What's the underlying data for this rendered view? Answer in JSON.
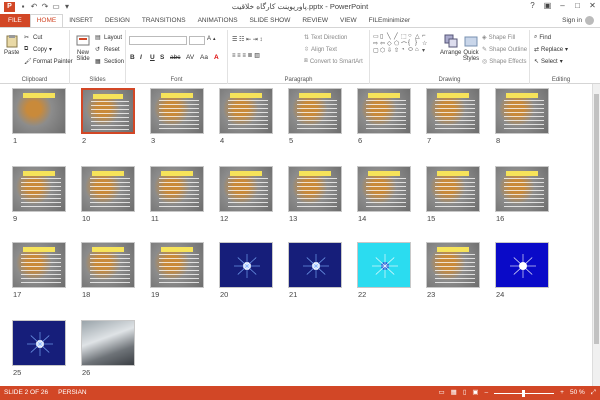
{
  "app": {
    "title": "پاورپوینت کارگاه خلاقیت.pptx - PowerPoint",
    "icon_letter": "P",
    "signin": "Sign in"
  },
  "tabs": [
    "FILE",
    "HOME",
    "INSERT",
    "DESIGN",
    "TRANSITIONS",
    "ANIMATIONS",
    "SLIDE SHOW",
    "REVIEW",
    "VIEW",
    "FILEminimizer"
  ],
  "active_tab": "HOME",
  "ribbon": {
    "clipboard": {
      "label": "Clipboard",
      "paste": "Paste",
      "cut": "Cut",
      "copy": "Copy",
      "format_painter": "Format Painter"
    },
    "slides": {
      "label": "Slides",
      "new_slide": "New Slide",
      "layout": "Layout",
      "reset": "Reset",
      "section": "Section"
    },
    "font": {
      "label": "Font",
      "bold": "B",
      "italic": "I",
      "underline": "U",
      "shadow": "S",
      "strike": "abc",
      "spacing": "AV",
      "case": "Aa",
      "color": "A"
    },
    "paragraph": {
      "label": "Paragraph",
      "text_direction": "Text Direction",
      "align_text": "Align Text",
      "convert": "Convert to SmartArt"
    },
    "drawing": {
      "label": "Drawing",
      "arrange": "Arrange",
      "quick_styles": "Quick Styles",
      "shape_fill": "Shape Fill",
      "shape_outline": "Shape Outline",
      "shape_effects": "Shape Effects"
    },
    "editing": {
      "label": "Editing",
      "find": "Find",
      "replace": "Replace",
      "select": "Select"
    }
  },
  "slides": [
    {
      "n": "1",
      "style": "title"
    },
    {
      "n": "2",
      "style": "text",
      "selected": true
    },
    {
      "n": "3",
      "style": "text"
    },
    {
      "n": "4",
      "style": "text"
    },
    {
      "n": "5",
      "style": "text"
    },
    {
      "n": "6",
      "style": "text"
    },
    {
      "n": "7",
      "style": "text"
    },
    {
      "n": "8",
      "style": "text"
    },
    {
      "n": "9",
      "style": "text"
    },
    {
      "n": "10",
      "style": "text"
    },
    {
      "n": "11",
      "style": "text"
    },
    {
      "n": "12",
      "style": "text"
    },
    {
      "n": "13",
      "style": "text"
    },
    {
      "n": "14",
      "style": "text"
    },
    {
      "n": "15",
      "style": "text"
    },
    {
      "n": "16",
      "style": "text"
    },
    {
      "n": "17",
      "style": "text"
    },
    {
      "n": "18",
      "style": "text"
    },
    {
      "n": "19",
      "style": "text"
    },
    {
      "n": "20",
      "style": "navy"
    },
    {
      "n": "21",
      "style": "navy"
    },
    {
      "n": "22",
      "style": "cyan"
    },
    {
      "n": "23",
      "style": "text"
    },
    {
      "n": "24",
      "style": "blue"
    },
    {
      "n": "25",
      "style": "navy"
    },
    {
      "n": "26",
      "style": "photo"
    }
  ],
  "status": {
    "slide_info": "SLIDE 2 OF 26",
    "language": "PERSIAN",
    "zoom": "50 %"
  },
  "colors": {
    "accent": "#d24726"
  }
}
